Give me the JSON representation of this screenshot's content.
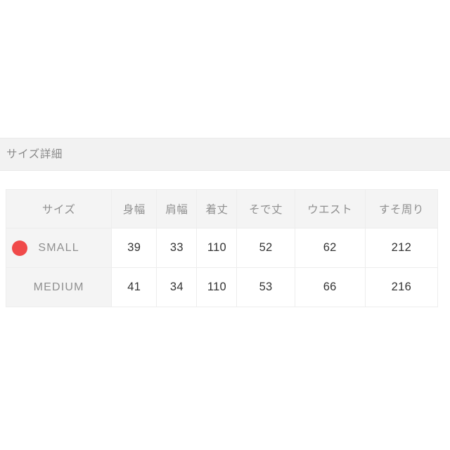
{
  "section": {
    "title": "サイズ詳細"
  },
  "table": {
    "headers": [
      "サイズ",
      "身幅",
      "肩幅",
      "着丈",
      "そで丈",
      "ウエスト",
      "すそ周り"
    ],
    "rows": [
      {
        "size": "SMALL",
        "marker": true,
        "marker_color": "#f04a4a",
        "values": [
          "39",
          "33",
          "110",
          "52",
          "62",
          "212"
        ]
      },
      {
        "size": "MEDIUM",
        "marker": false,
        "marker_color": "",
        "values": [
          "41",
          "34",
          "110",
          "53",
          "66",
          "216"
        ]
      }
    ]
  },
  "colors": {
    "page_background": "#ffffff",
    "band_background": "#f2f2f2",
    "header_cell_background": "#f4f4f4",
    "cell_border": "#ededed",
    "muted_text": "#8f8f8f",
    "value_text": "#333333",
    "marker_red": "#f04a4a"
  }
}
